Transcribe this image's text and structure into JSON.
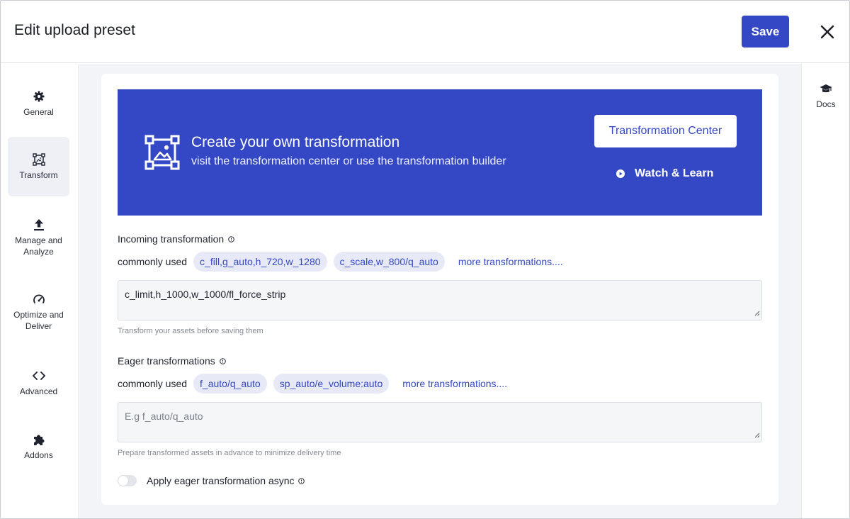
{
  "header": {
    "title": "Edit upload preset",
    "save_label": "Save"
  },
  "nav": {
    "items": [
      {
        "label": "General",
        "icon": "gear-icon"
      },
      {
        "label": "Transform",
        "icon": "transform-icon",
        "active": true
      },
      {
        "label": "Manage and Analyze",
        "icon": "upload-arrow-icon"
      },
      {
        "label": "Optimize and Deliver",
        "icon": "speedometer-icon"
      },
      {
        "label": "Advanced",
        "icon": "code-brackets-icon"
      },
      {
        "label": "Addons",
        "icon": "puzzle-icon"
      }
    ]
  },
  "rail": {
    "docs_label": "Docs",
    "docs_icon": "graduation-cap-icon"
  },
  "banner": {
    "title": "Create your own transformation",
    "subtitle": "visit the transformation center or use the transformation builder",
    "center_button": "Transformation Center",
    "watch_label": "Watch & Learn",
    "bg_color": "#3448c5"
  },
  "incoming": {
    "label": "Incoming transformation",
    "commonly_used": "commonly used",
    "chips": [
      "c_fill,g_auto,h_720,w_1280",
      "c_scale,w_800/q_auto"
    ],
    "more": "more transformations....",
    "value": "c_limit,h_1000,w_1000/fl_force_strip",
    "helper": "Transform your assets before saving them"
  },
  "eager": {
    "label": "Eager transformations",
    "commonly_used": "commonly used",
    "chips": [
      "f_auto/q_auto",
      "sp_auto/e_volume:auto"
    ],
    "more": "more transformations....",
    "placeholder": "E.g f_auto/q_auto",
    "helper": "Prepare transformed assets in advance to minimize delivery time",
    "async_label": "Apply eager transformation async",
    "async_enabled": false
  },
  "colors": {
    "accent": "#3448c5",
    "chip_bg": "#e7e9f7"
  }
}
